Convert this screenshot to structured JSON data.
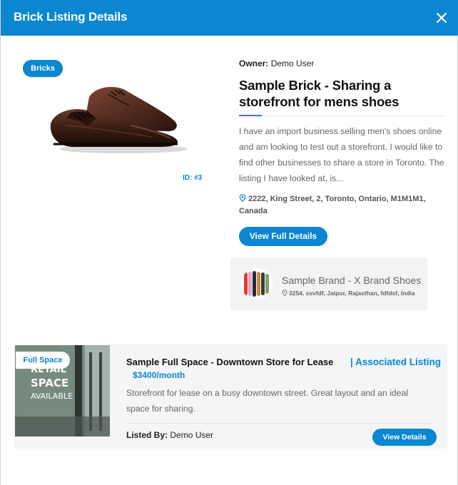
{
  "modal": {
    "title": "Brick Listing Details",
    "header_color": "#0b86d0",
    "close_icon": "close-icon"
  },
  "brick": {
    "badge": "Bricks",
    "image_icon": "shoe-image",
    "id_label": "ID: #3",
    "owner_label": "Owner:",
    "owner_name": "Demo User",
    "title": "Sample Brick - Sharing a storefront for mens shoes",
    "description": "I have an import business selling men's shoes online and am looking to test out a storefront. I would like to find other businesses to share a store in Toronto. The listing I have looked at, is...",
    "address": "2222, King Street, 2, Toronto, Ontario, M1M1M1, Canada",
    "view_full_details": "View Full Details"
  },
  "brand": {
    "name": "Sample Brand - X Brand Shoes",
    "address": "3254, xsvfdf, Jaipur, Rajasthan, fdfdsf, India"
  },
  "associated_space": {
    "badge": "Full Space",
    "title": "Sample Full Space - Downtown Store for Lease",
    "associated_label": "| Associated Listing",
    "price": "$3400/month",
    "description": "Storefront for lease on a busy downtown street. Great layout and an ideal space for sharing.",
    "listed_by_label": "Listed By:",
    "listed_by_name": "Demo User",
    "view_details": "View Details",
    "image_text": [
      "RETAIL",
      "SPACE",
      "AVAILABLE"
    ]
  },
  "colors": {
    "accent": "#0b86d0",
    "card_bg": "#f4f5f6"
  }
}
